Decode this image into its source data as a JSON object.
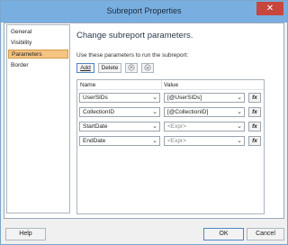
{
  "window": {
    "title": "Subreport Properties",
    "close_glyph": "✕"
  },
  "nav": {
    "items": [
      {
        "label": "General",
        "active": false
      },
      {
        "label": "Visibility",
        "active": false
      },
      {
        "label": "Parameters",
        "active": true
      },
      {
        "label": "Border",
        "active": false
      }
    ]
  },
  "main": {
    "heading": "Change subreport parameters.",
    "hint": "Use these parameters to run the subreport:",
    "toolbar": {
      "add_label": "Add",
      "delete_label": "Delete",
      "move_up_icon": "arrow-up-icon",
      "move_down_icon": "arrow-down-icon"
    },
    "columns": {
      "name": "Name",
      "value": "Value"
    },
    "rows": [
      {
        "name": "UserSIDs",
        "value": "[@UserSIDs]",
        "value_is_placeholder": false
      },
      {
        "name": "CollectionID",
        "value": "[@CollectionID]",
        "value_is_placeholder": false
      },
      {
        "name": "StartDate",
        "value": "<Expr>",
        "value_is_placeholder": true
      },
      {
        "name": "EndDate",
        "value": "<Expr>",
        "value_is_placeholder": true
      }
    ],
    "fx_label": "fx"
  },
  "footer": {
    "help_label": "Help",
    "ok_label": "OK",
    "cancel_label": "Cancel"
  },
  "colors": {
    "titlebar": "#79aee0",
    "active_nav": "#f5c483",
    "close": "#c7473d"
  }
}
